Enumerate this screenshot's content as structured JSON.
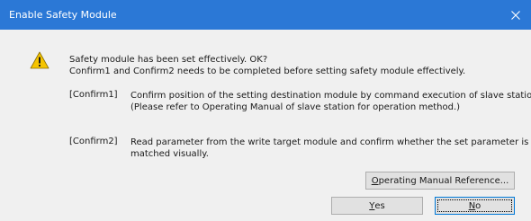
{
  "window": {
    "title": "Enable Safety Module",
    "close_icon": "close-icon"
  },
  "message": {
    "icon": "warning-icon",
    "line1": "Safety module has been set effectively. OK?",
    "line2": "Confirm1 and Confirm2 needs to be completed before setting safety module effectively."
  },
  "confirms": [
    {
      "tag": "[Confirm1]",
      "line1": "Confirm position of the setting destination module by command execution of slave station",
      "line2": "(Please refer to Operating Manual of slave station for operation method.)"
    },
    {
      "tag": "[Confirm2]",
      "line1": "Read parameter from the write target module and confirm whether the set parameter is",
      "line2": "matched visually."
    }
  ],
  "buttons": {
    "reference": {
      "mnemonic": "O",
      "rest": "perating Manual Reference..."
    },
    "yes": {
      "mnemonic": "Y",
      "rest": "es"
    },
    "no": {
      "mnemonic": "N",
      "rest": "o"
    }
  }
}
